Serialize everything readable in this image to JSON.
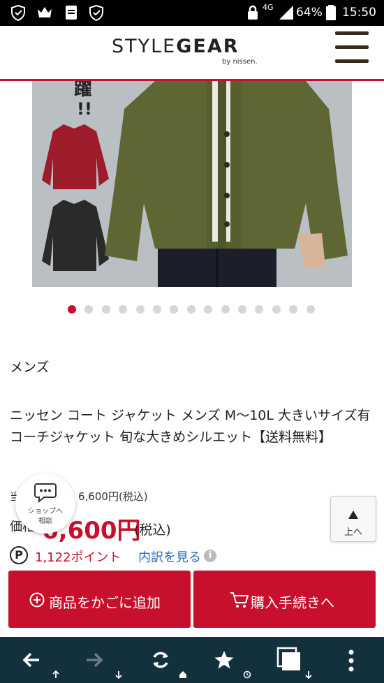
{
  "status_bar": {
    "network": "4G",
    "battery": "64%",
    "time": "15:50"
  },
  "header": {
    "logo_light": "STYLE",
    "logo_bold": "GEAR",
    "logo_sub": "by nissen."
  },
  "carousel": {
    "total": 15,
    "active_index": 0
  },
  "product": {
    "category": "メンズ",
    "title": "ニッセン コート ジャケット メンズ M〜10L 大きいサイズ有 コーチジャケット 旬な大きめシルエット【送料無料】",
    "current_price_label": "当",
    "current_price_value": "6,600円(税込)",
    "price_label": "価格",
    "price_big": "6,600円",
    "price_tax": "(税込)",
    "points": "1,122ポイント",
    "points_breakdown": "内訳を見る"
  },
  "chat": {
    "label_line1": "ショップへ",
    "label_line2": "相談"
  },
  "to_top": {
    "label": "上へ"
  },
  "actions": {
    "add_to_cart": "商品をかごに追加",
    "checkout": "購入手続きへ"
  },
  "colors": {
    "accent": "#c8102e",
    "nav_bg": "#13303d",
    "link": "#2a6cb8"
  }
}
